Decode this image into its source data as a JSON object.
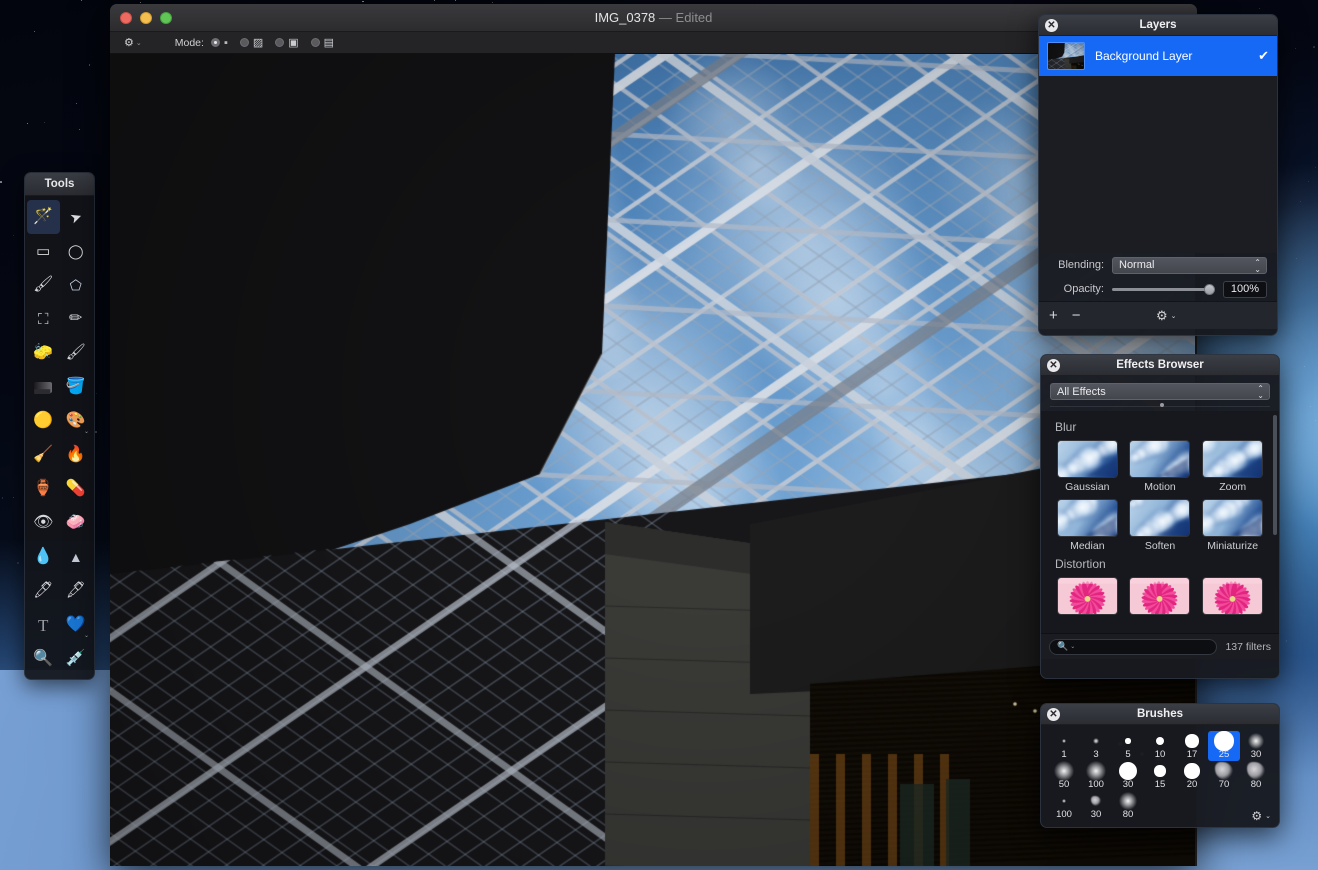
{
  "desktop": {
    "name": "desktop-background"
  },
  "document_window": {
    "title": "IMG_0378",
    "separator": "—",
    "edited_badge": "Edited",
    "traffic_lights": [
      "close",
      "minimize",
      "zoom"
    ],
    "toolbar": {
      "gear_label": "⚙",
      "gear_chevron": "⌄",
      "mode_label": "Mode:",
      "mode_options": [
        {
          "name": "replace",
          "selected": true
        },
        {
          "name": "add",
          "selected": false
        },
        {
          "name": "subtract",
          "selected": false
        },
        {
          "name": "intersect",
          "selected": false
        }
      ]
    }
  },
  "tools_palette": {
    "title": "Tools",
    "items": [
      {
        "name": "magic-wand-tool",
        "glyph": "🪄",
        "selected": true,
        "sub": false
      },
      {
        "name": "arrow-select-tool",
        "glyph": "➤",
        "selected": false,
        "sub": false
      },
      {
        "name": "rectangular-marquee-tool",
        "glyph": "▧",
        "selected": false,
        "sub": false
      },
      {
        "name": "elliptical-marquee-tool",
        "glyph": "◌",
        "selected": false,
        "sub": false
      },
      {
        "name": "quick-select-tool",
        "glyph": "🖌",
        "selected": false,
        "sub": false
      },
      {
        "name": "lasso-tool",
        "glyph": "⌁",
        "selected": false,
        "sub": false
      },
      {
        "name": "crop-tool",
        "glyph": "⛶",
        "selected": false,
        "sub": false
      },
      {
        "name": "pencil-tool",
        "glyph": "✏",
        "selected": false,
        "sub": false
      },
      {
        "name": "eraser-tool",
        "glyph": "🧽",
        "selected": false,
        "sub": false
      },
      {
        "name": "paintbrush-tool",
        "glyph": "🖌",
        "selected": false,
        "sub": false
      },
      {
        "name": "gradient-tool",
        "glyph": "▬",
        "selected": false,
        "sub": false
      },
      {
        "name": "paint-bucket-tool",
        "glyph": "🪣",
        "selected": false,
        "sub": false
      },
      {
        "name": "dodge-tool",
        "glyph": "🟡",
        "selected": false,
        "sub": false
      },
      {
        "name": "color-palette-tool",
        "glyph": "🎨",
        "selected": false,
        "sub": true
      },
      {
        "name": "smudge-tool",
        "glyph": "🧹",
        "selected": false,
        "sub": false
      },
      {
        "name": "burn-tool",
        "glyph": "🔥",
        "selected": false,
        "sub": false
      },
      {
        "name": "clone-stamp-tool",
        "glyph": "🏺",
        "selected": false,
        "sub": false
      },
      {
        "name": "healing-brush-tool",
        "glyph": "💊",
        "selected": false,
        "sub": false
      },
      {
        "name": "red-eye-tool",
        "glyph": "👁",
        "selected": false,
        "sub": false
      },
      {
        "name": "eraser-block-tool",
        "glyph": "🧼",
        "selected": false,
        "sub": false
      },
      {
        "name": "blur-tool",
        "glyph": "💧",
        "selected": false,
        "sub": false
      },
      {
        "name": "sharpen-tool",
        "glyph": "🔺",
        "selected": false,
        "sub": false
      },
      {
        "name": "pen-tool",
        "glyph": "🖊",
        "selected": false,
        "sub": false
      },
      {
        "name": "freehand-pen-tool",
        "glyph": "🖋",
        "selected": false,
        "sub": false
      },
      {
        "name": "text-tool",
        "glyph": "T",
        "selected": false,
        "sub": false
      },
      {
        "name": "shape-tool",
        "glyph": "💙",
        "selected": false,
        "sub": true
      },
      {
        "name": "zoom-tool",
        "glyph": "🔍",
        "selected": false,
        "sub": false
      },
      {
        "name": "eyedropper-tool",
        "glyph": "💉",
        "selected": false,
        "sub": false
      }
    ]
  },
  "layers_panel": {
    "title": "Layers",
    "close_glyph": "✕",
    "layers": [
      {
        "name": "Background Layer",
        "visible": true,
        "checkmark": "✔",
        "selected": true
      }
    ],
    "blending_label": "Blending:",
    "blending_value": "Normal",
    "blending_options": [
      "Normal"
    ],
    "opacity_label": "Opacity:",
    "opacity_value": "100%",
    "opacity_percent": 100,
    "footer": {
      "add_label": "+",
      "remove_label": "−",
      "gear_label": "⚙",
      "gear_chevron": "⌄"
    }
  },
  "effects_panel": {
    "title": "Effects Browser",
    "close_glyph": "✕",
    "category_value": "All Effects",
    "groups": [
      {
        "name": "Blur",
        "effects": [
          {
            "label": "Gaussian",
            "thumb": "blur"
          },
          {
            "label": "Motion",
            "thumb": "blur"
          },
          {
            "label": "Zoom",
            "thumb": "blur"
          },
          {
            "label": "Median",
            "thumb": "blur"
          },
          {
            "label": "Soften",
            "thumb": "blur"
          },
          {
            "label": "Miniaturize",
            "thumb": "blur"
          }
        ]
      },
      {
        "name": "Distortion",
        "effects": [
          {
            "label": "",
            "thumb": "flower"
          },
          {
            "label": "",
            "thumb": "flower"
          },
          {
            "label": "",
            "thumb": "flower"
          }
        ]
      }
    ],
    "search_placeholder": "",
    "search_icon": "search-icon",
    "filter_count": "137 filters"
  },
  "brushes_panel": {
    "title": "Brushes",
    "close_glyph": "✕",
    "brushes": [
      {
        "size": "1",
        "dot": 1.2,
        "soft": 0.6,
        "texture": "none",
        "selected": false
      },
      {
        "size": "3",
        "dot": 1.6,
        "soft": 0.8,
        "texture": "none",
        "selected": false
      },
      {
        "size": "5",
        "dot": 2.6,
        "soft": 0.2,
        "texture": "none",
        "selected": false
      },
      {
        "size": "10",
        "dot": 4.4,
        "soft": 0.0,
        "texture": "none",
        "selected": false
      },
      {
        "size": "17",
        "dot": 6.6,
        "soft": 0.0,
        "texture": "none",
        "selected": false
      },
      {
        "size": "25",
        "dot": 9.6,
        "soft": 0.0,
        "texture": "none",
        "selected": true
      },
      {
        "size": "30",
        "dot": 5.2,
        "soft": 0.9,
        "texture": "none",
        "selected": false
      },
      {
        "size": "50",
        "dot": 6.2,
        "soft": 1.0,
        "texture": "none",
        "selected": false
      },
      {
        "size": "100",
        "dot": 6.2,
        "soft": 1.0,
        "texture": "none",
        "selected": false
      },
      {
        "size": "30",
        "dot": 9.4,
        "soft": 0.0,
        "texture": "none",
        "selected": false
      },
      {
        "size": "15",
        "dot": 5.6,
        "soft": 0.0,
        "texture": "none",
        "selected": false
      },
      {
        "size": "20",
        "dot": 7.6,
        "soft": 0.0,
        "texture": "none",
        "selected": false
      },
      {
        "size": "70",
        "dot": 9.0,
        "soft": 0.0,
        "texture": "splat",
        "selected": false
      },
      {
        "size": "80",
        "dot": 9.0,
        "soft": 0.0,
        "texture": "splat",
        "selected": false
      },
      {
        "size": "100",
        "dot": 1.4,
        "soft": 0.9,
        "texture": "none",
        "selected": false
      },
      {
        "size": "30",
        "dot": 5.0,
        "soft": 0.0,
        "texture": "splat",
        "selected": false
      },
      {
        "size": "80",
        "dot": 5.4,
        "soft": 0.4,
        "texture": "none",
        "selected": false
      }
    ],
    "gear_label": "⚙",
    "gear_chevron": "⌄"
  },
  "colors": {
    "selection_blue": "#1569f5",
    "panel_bg": "#181a20",
    "header_bg": "#2e3138",
    "text_primary": "#e8e8ea",
    "text_secondary": "#b4b4ba",
    "window_chrome": "#323235"
  }
}
